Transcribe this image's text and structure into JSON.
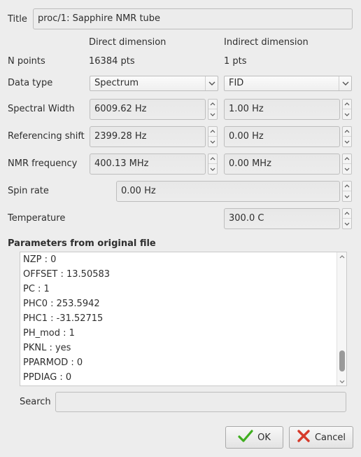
{
  "title": {
    "label": "Title",
    "value": "proc/1: Sapphire NMR tube"
  },
  "headers": {
    "direct": "Direct dimension",
    "indirect": "Indirect dimension"
  },
  "rows": {
    "npoints": {
      "label": "N points",
      "direct": "16384 pts",
      "indirect": "1 pts"
    },
    "datatype": {
      "label": "Data type",
      "direct": "Spectrum",
      "indirect": "FID"
    },
    "spectral_width": {
      "label": "Spectral Width",
      "direct": "6009.62 Hz",
      "indirect": "1.00 Hz"
    },
    "referencing_shift": {
      "label": "Referencing shift",
      "direct": "2399.28 Hz",
      "indirect": "0.00 Hz"
    },
    "nmr_frequency": {
      "label": "NMR frequency",
      "direct": "400.13 MHz",
      "indirect": "0.00 MHz"
    },
    "spin_rate": {
      "label": "Spin rate",
      "value": "0.00 Hz"
    },
    "temperature": {
      "label": "Temperature",
      "value": "300.0 C"
    }
  },
  "params": {
    "heading": "Parameters from original file",
    "items": [
      "NZP :  0",
      "OFFSET :  13.50583",
      "PC :  1",
      "PHC0 :  253.5942",
      "PHC1 :  -31.52715",
      "PH_mod :  1",
      "PKNL :  yes",
      "PPARMOD :  0",
      "PPDIAG :  0"
    ]
  },
  "search": {
    "label": "Search",
    "value": ""
  },
  "buttons": {
    "ok": "OK",
    "cancel": "Cancel"
  },
  "icons": {
    "ok": "check-icon",
    "cancel": "cross-icon"
  },
  "colors": {
    "ok_green": "#3fae1f",
    "cancel_red": "#d63a2a"
  }
}
